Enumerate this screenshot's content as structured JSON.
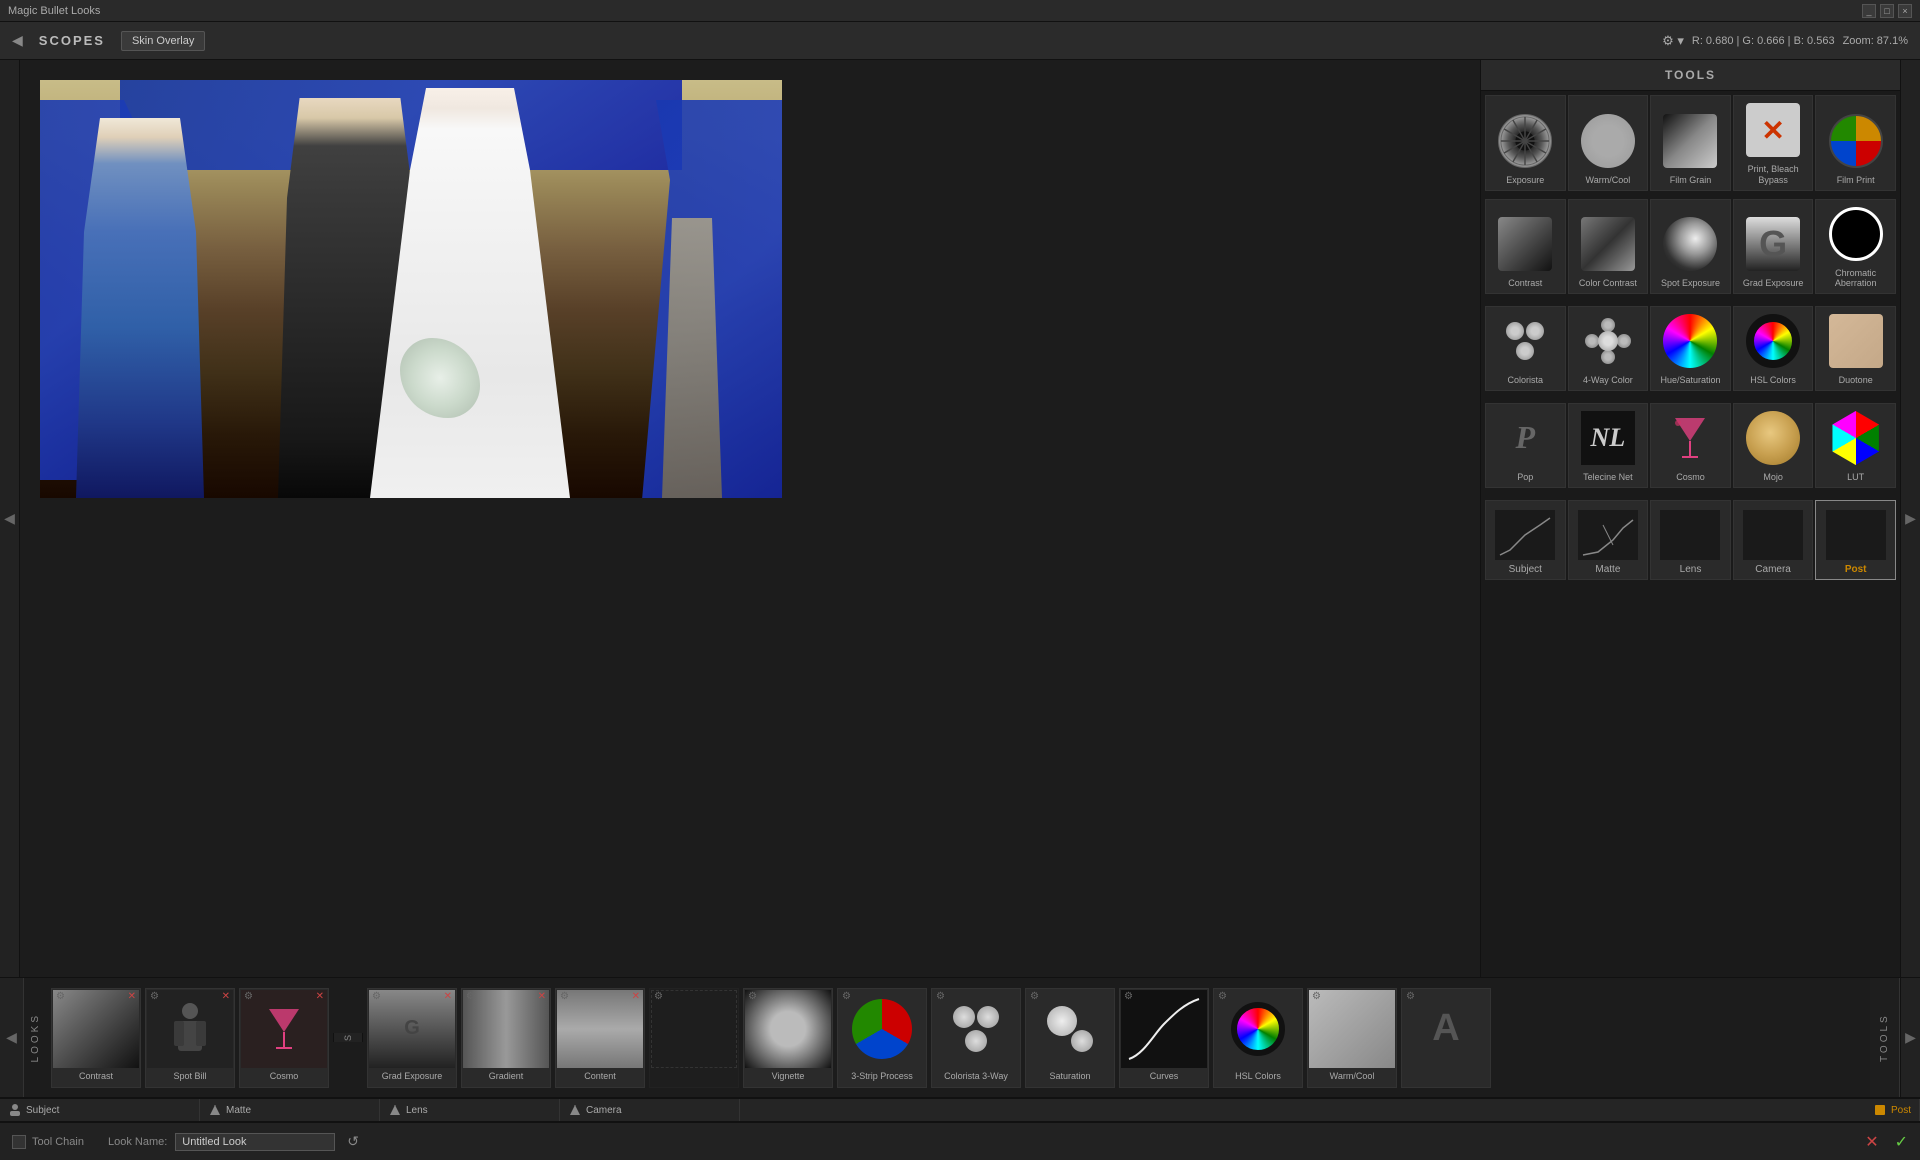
{
  "app": {
    "title": "Magic Bullet Looks",
    "title_bar_controls": [
      "_",
      "□",
      "×"
    ]
  },
  "top_bar": {
    "arrow": "◀",
    "scopes": "SCOPES",
    "skin_overlay_btn": "Skin Overlay",
    "rgb_info": "R: 0.680 | G: 0.666 | B: 0.563",
    "zoom_info": "Zoom: 87.1%"
  },
  "tools_panel": {
    "title": "TOOLS",
    "rows": [
      [
        {
          "label": "Exposure",
          "icon": "aperture"
        },
        {
          "label": "Warm/Cool",
          "icon": "warmcool"
        },
        {
          "label": "Film Grain",
          "icon": "filmgrain"
        },
        {
          "label": "Print, Bleach Bypass",
          "icon": "printbleach"
        },
        {
          "label": "Film Print",
          "icon": "filmprint"
        }
      ],
      [
        {
          "label": "Contrast",
          "icon": "contrast"
        },
        {
          "label": "Color Contrast",
          "icon": "colorcontrast"
        },
        {
          "label": "Spot Exposure",
          "icon": "spotexposure"
        },
        {
          "label": "Grad Exposure",
          "icon": "gradexposure"
        },
        {
          "label": "Chromatic Aberration",
          "icon": "chromatic"
        }
      ],
      [
        {
          "label": "Colorista",
          "icon": "colorista"
        },
        {
          "label": "4-Way Color",
          "icon": "4waycolor"
        },
        {
          "label": "Hue/Saturation",
          "icon": "huesaturation"
        },
        {
          "label": "HSL Colors",
          "icon": "hslcolors"
        },
        {
          "label": "Duotone",
          "icon": "duotone"
        }
      ],
      [
        {
          "label": "Pop",
          "icon": "pop"
        },
        {
          "label": "Telecine Net",
          "icon": "telecinenet"
        },
        {
          "label": "Cosmo",
          "icon": "cosmo"
        },
        {
          "label": "Mojo",
          "icon": "mojo"
        },
        {
          "label": "LUT",
          "icon": "lut"
        }
      ]
    ],
    "categories": [
      {
        "label": "Subject",
        "active": false
      },
      {
        "label": "Matte",
        "active": false
      },
      {
        "label": "Lens",
        "active": false
      },
      {
        "label": "Camera",
        "active": false
      },
      {
        "label": "Post",
        "active": true,
        "post": true
      }
    ]
  },
  "looks_strip": {
    "items": [
      {
        "label": "Contrast",
        "type": "contrast",
        "has_close": true
      },
      {
        "label": "Spot Bill",
        "type": "spotbill",
        "has_close": true
      },
      {
        "label": "Cosmo",
        "type": "cosmo",
        "has_close": true
      },
      {
        "label": "Grad Exposure",
        "type": "gradexp",
        "has_close": true
      },
      {
        "label": "Gradient",
        "type": "gradient",
        "has_close": true
      },
      {
        "label": "Content",
        "type": "content",
        "has_close": true
      },
      {
        "label": "Vignette",
        "type": "vignette",
        "has_close": false
      },
      {
        "label": "3-Strip Process",
        "type": "3strip",
        "has_close": false
      },
      {
        "label": "Colorista 3-Way",
        "type": "colorista3way",
        "has_close": false
      },
      {
        "label": "Saturation",
        "type": "saturation",
        "has_close": false
      },
      {
        "label": "Curves",
        "type": "curves",
        "has_close": false
      },
      {
        "label": "HSL Colors",
        "type": "hslcolors",
        "has_close": false
      },
      {
        "label": "Warm/Cool",
        "type": "warmcool",
        "has_close": false
      },
      {
        "label": "A",
        "type": "a",
        "has_close": false
      }
    ],
    "sections": [
      {
        "label": "LOOKS",
        "items_count": 3
      },
      {
        "label": "Subject"
      },
      {
        "label": "Matte"
      },
      {
        "label": "Lens"
      },
      {
        "label": "Camera"
      },
      {
        "label": "Post"
      }
    ]
  },
  "track_labels": [
    {
      "label": "Subject",
      "icon": "person"
    },
    {
      "label": "Matte",
      "icon": "arrow"
    },
    {
      "label": "Lens",
      "icon": "arrow"
    },
    {
      "label": "Camera",
      "icon": "arrow"
    },
    {
      "label": "Post",
      "icon": "star",
      "is_post": true
    }
  ],
  "bottom_toolbar": {
    "toolchain_label": "Tool Chain",
    "lookname_label": "Look Name:",
    "lookname_value": "Untitled Look",
    "reset_icon": "↺"
  }
}
